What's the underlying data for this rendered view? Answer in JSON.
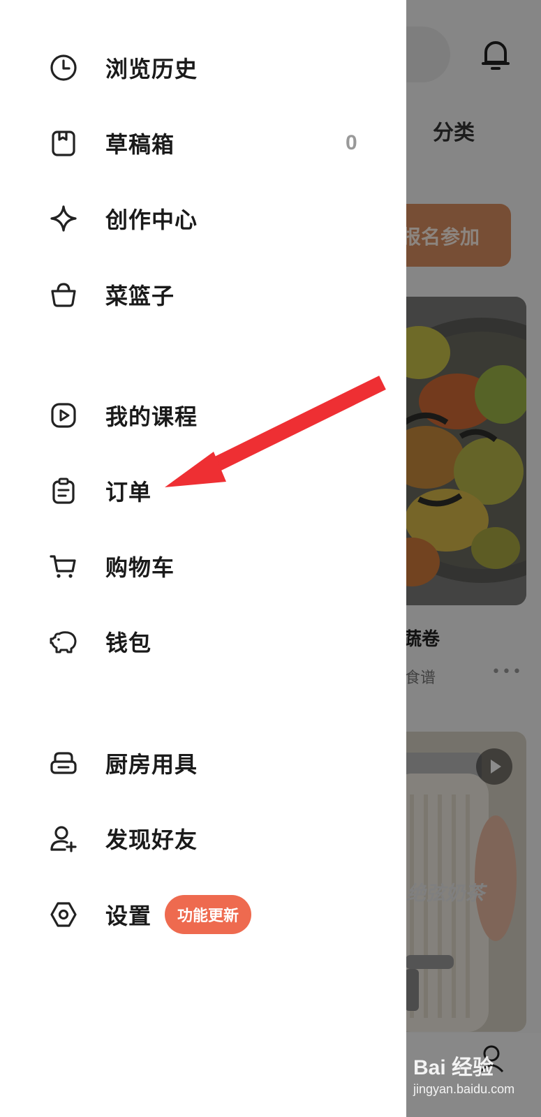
{
  "drawer": {
    "items": [
      {
        "label": "浏览历史",
        "icon": "clock-icon"
      },
      {
        "label": "草稿箱",
        "icon": "draft-box-icon",
        "count": "0"
      },
      {
        "label": "创作中心",
        "icon": "sparkle-star-icon"
      },
      {
        "label": "菜篮子",
        "icon": "basket-icon"
      },
      {
        "label": "我的课程",
        "icon": "play-square-icon"
      },
      {
        "label": "订单",
        "icon": "clipboard-icon"
      },
      {
        "label": "购物车",
        "icon": "cart-icon"
      },
      {
        "label": "钱包",
        "icon": "piggy-bank-icon"
      },
      {
        "label": "厨房用具",
        "icon": "kitchen-tool-icon"
      },
      {
        "label": "发现好友",
        "icon": "add-friend-icon"
      },
      {
        "label": "设置",
        "icon": "settings-hexagon-icon",
        "badge": "功能更新"
      }
    ]
  },
  "background": {
    "tab_label": "分类",
    "banner_text": "报名参加",
    "card1_title": "蔬卷",
    "card1_sub": "食谱",
    "card1_more": "•••",
    "card2_text": "绝弦奶茶"
  },
  "watermark": {
    "main": "Bai 经验",
    "url": "jingyan.baidu.com"
  },
  "colors": {
    "badge": "#ee6a4f",
    "arrow": "#ee2f33",
    "count": "#999999",
    "overlay": "rgba(0,0,0,0.45)"
  }
}
